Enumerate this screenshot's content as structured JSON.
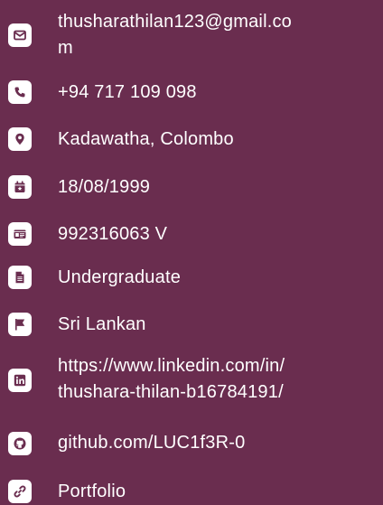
{
  "contact": {
    "email": "thusharathilan123@gmail.co m",
    "email_line1": "thusharathilan123@gmail.co",
    "email_line2": "m",
    "phone": "+94 717 109 098",
    "location": "Kadawatha, Colombo",
    "birthdate": "18/08/1999",
    "nic": "992316063 V",
    "education": "Undergraduate",
    "nationality": "Sri Lankan",
    "linkedin_line1": "https://www.linkedin.com/in/",
    "linkedin_line2": "thushara-thilan-b16784191/",
    "github": "github.com/LUC1f3R-0",
    "portfolio": "Portfolio"
  },
  "icons": {
    "email": "envelope-icon",
    "phone": "phone-icon",
    "location": "map-pin-icon",
    "birthdate": "calendar-star-icon",
    "nic": "id-card-icon",
    "education": "document-icon",
    "nationality": "flag-icon",
    "linkedin": "linkedin-icon",
    "github": "github-icon",
    "portfolio": "link-icon"
  },
  "colors": {
    "background": "#6a2d4f",
    "icon_bg": "#ffffff",
    "icon_fg": "#6a2d4f",
    "text": "#ffffff"
  }
}
